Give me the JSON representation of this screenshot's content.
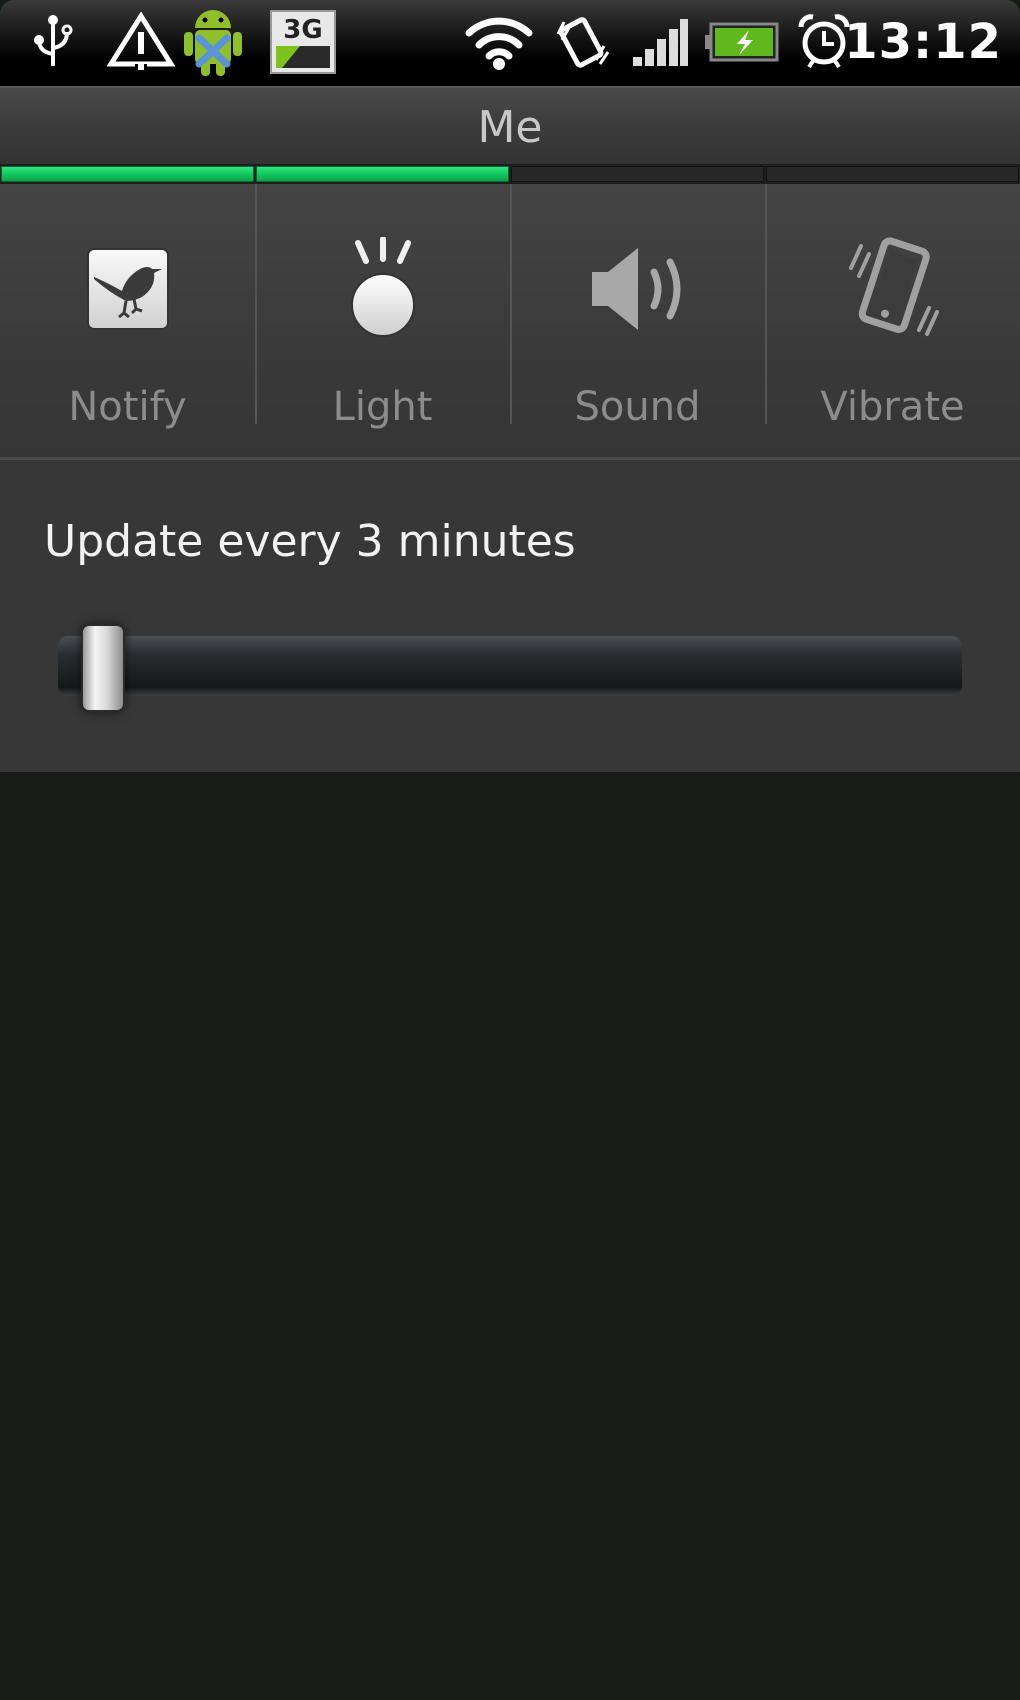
{
  "status_bar": {
    "icons": [
      {
        "name": "usb-icon",
        "glyph": "usb"
      },
      {
        "name": "warning-icon",
        "glyph": "warning"
      },
      {
        "name": "android-debug-icon",
        "glyph": "android"
      },
      {
        "name": "3g-icon",
        "glyph": "3G"
      },
      {
        "name": "wifi-icon",
        "glyph": "wifi"
      },
      {
        "name": "vibrate-mode-icon",
        "glyph": "vibrate"
      },
      {
        "name": "signal-icon",
        "glyph": "signal"
      },
      {
        "name": "battery-charging-icon",
        "glyph": "battery"
      },
      {
        "name": "alarm-icon",
        "glyph": "alarm"
      }
    ],
    "network_label": "3G",
    "time": "13:12"
  },
  "title_bar": {
    "title": "Me"
  },
  "colors": {
    "indicator_on": "#1ed46a",
    "indicator_off": "#272727",
    "label_text": "#8c8c8c"
  },
  "toggles": [
    {
      "id": "notify",
      "label": "Notify",
      "icon": "bird-icon",
      "enabled": true
    },
    {
      "id": "light",
      "label": "Light",
      "icon": "led-light-icon",
      "enabled": true
    },
    {
      "id": "sound",
      "label": "Sound",
      "icon": "speaker-icon",
      "enabled": false
    },
    {
      "id": "vibrate",
      "label": "Vibrate",
      "icon": "vibrate-phone-icon",
      "enabled": false
    }
  ],
  "update_interval": {
    "label": "Update every 3 minutes",
    "value_minutes": 3,
    "slider_fraction": 0.02
  }
}
